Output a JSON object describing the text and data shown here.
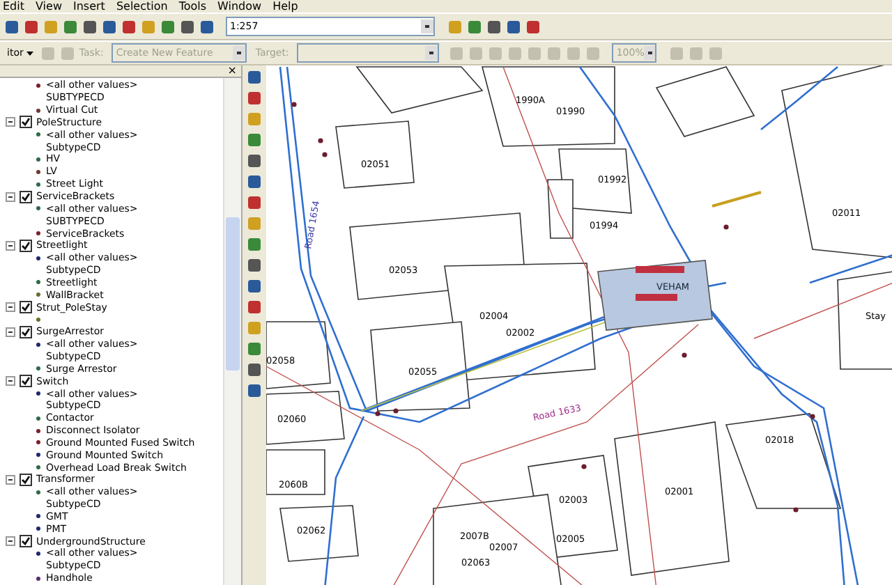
{
  "menu": [
    "Edit",
    "View",
    "Insert",
    "Selection",
    "Tools",
    "Window",
    "Help"
  ],
  "scale": {
    "value": "1:257"
  },
  "editor": {
    "label": "itor",
    "task_label": "Task:",
    "task_value": "Create New Feature",
    "target_label": "Target:",
    "zoom_value": "100%"
  },
  "toc": {
    "close": "×",
    "layers": [
      {
        "items": [
          {
            "label": "<all other values>",
            "kind": "value",
            "color": "#7b1e2e"
          },
          {
            "label": "SUBTYPECD",
            "kind": "field"
          },
          {
            "label": "Virtual Cut",
            "kind": "value",
            "color": "#6b3a2e"
          }
        ]
      },
      {
        "name": "PoleStructure",
        "checked": true,
        "expanded": true,
        "items": [
          {
            "label": "<all other values>",
            "kind": "value",
            "color": "#2e6b4a"
          },
          {
            "label": "SubtypeCD",
            "kind": "field"
          },
          {
            "label": "HV",
            "kind": "value",
            "color": "#2e6b4a"
          },
          {
            "label": "LV",
            "kind": "value",
            "color": "#6b3a2e"
          },
          {
            "label": "Street Light",
            "kind": "value",
            "color": "#2e6b4a"
          }
        ]
      },
      {
        "name": "ServiceBrackets",
        "checked": true,
        "expanded": true,
        "items": [
          {
            "label": "<all other values>",
            "kind": "value",
            "color": "#2e6b4a"
          },
          {
            "label": "SUBTYPECD",
            "kind": "field"
          },
          {
            "label": "ServiceBrackets",
            "kind": "value",
            "color": "#7b1e2e"
          }
        ]
      },
      {
        "name": "Streetlight",
        "checked": true,
        "expanded": true,
        "items": [
          {
            "label": "<all other values>",
            "kind": "value",
            "color": "#1f2a6b"
          },
          {
            "label": "SubtypeCD",
            "kind": "field"
          },
          {
            "label": "Streetlight",
            "kind": "value",
            "color": "#2e6b4a"
          },
          {
            "label": "WallBracket",
            "kind": "value",
            "color": "#6b6b2e"
          }
        ]
      },
      {
        "name": "Strut_PoleStay",
        "checked": true,
        "expanded": true,
        "items": [
          {
            "kind": "value",
            "color": "#6b6b2e"
          }
        ]
      },
      {
        "name": "SurgeArrestor",
        "checked": true,
        "expanded": true,
        "items": [
          {
            "label": "<all other values>",
            "kind": "value",
            "color": "#1f2a6b"
          },
          {
            "label": "SubtypeCD",
            "kind": "field"
          },
          {
            "label": "Surge Arrestor",
            "kind": "value",
            "color": "#2e6b4a"
          }
        ]
      },
      {
        "name": "Switch",
        "checked": true,
        "expanded": true,
        "items": [
          {
            "label": "<all other values>",
            "kind": "value",
            "color": "#1f2a6b"
          },
          {
            "label": "SubtypeCD",
            "kind": "field"
          },
          {
            "label": "Contactor",
            "kind": "value",
            "color": "#2e6b4a"
          },
          {
            "label": "Disconnect Isolator",
            "kind": "value",
            "color": "#7b1e2e"
          },
          {
            "label": "Ground Mounted Fused Switch",
            "kind": "value",
            "color": "#7b1e2e"
          },
          {
            "label": "Ground Mounted Switch",
            "kind": "value",
            "color": "#1f2a6b"
          },
          {
            "label": "Overhead Load Break Switch",
            "kind": "value",
            "color": "#2e6b4a"
          }
        ]
      },
      {
        "name": "Transformer",
        "checked": true,
        "expanded": true,
        "items": [
          {
            "label": "<all other values>",
            "kind": "value",
            "color": "#2e6b4a"
          },
          {
            "label": "SubtypeCD",
            "kind": "field"
          },
          {
            "label": "GMT",
            "kind": "value",
            "color": "#1f2a6b"
          },
          {
            "label": "PMT",
            "kind": "value",
            "color": "#1f2a6b"
          }
        ]
      },
      {
        "name": "UndergroundStructure",
        "checked": true,
        "expanded": true,
        "items": [
          {
            "label": "<all other values>",
            "kind": "value",
            "color": "#1f2a6b"
          },
          {
            "label": "SubtypeCD",
            "kind": "field"
          },
          {
            "label": "Handhole",
            "kind": "value",
            "color": "#5a2e6b"
          }
        ]
      }
    ]
  },
  "map": {
    "parcel_labels": [
      "1990A",
      "01990",
      "02051",
      "01992",
      "01994",
      "02011",
      "02053",
      "02004",
      "02002",
      "02058",
      "02055",
      "02060",
      "02018",
      "2060B",
      "02001",
      "02003",
      "02062",
      "2007B",
      "02007",
      "02005",
      "02063",
      "Stay"
    ],
    "road_labels": [
      "Road 1654",
      "Road 1633"
    ],
    "building_label": "VEHAM"
  }
}
